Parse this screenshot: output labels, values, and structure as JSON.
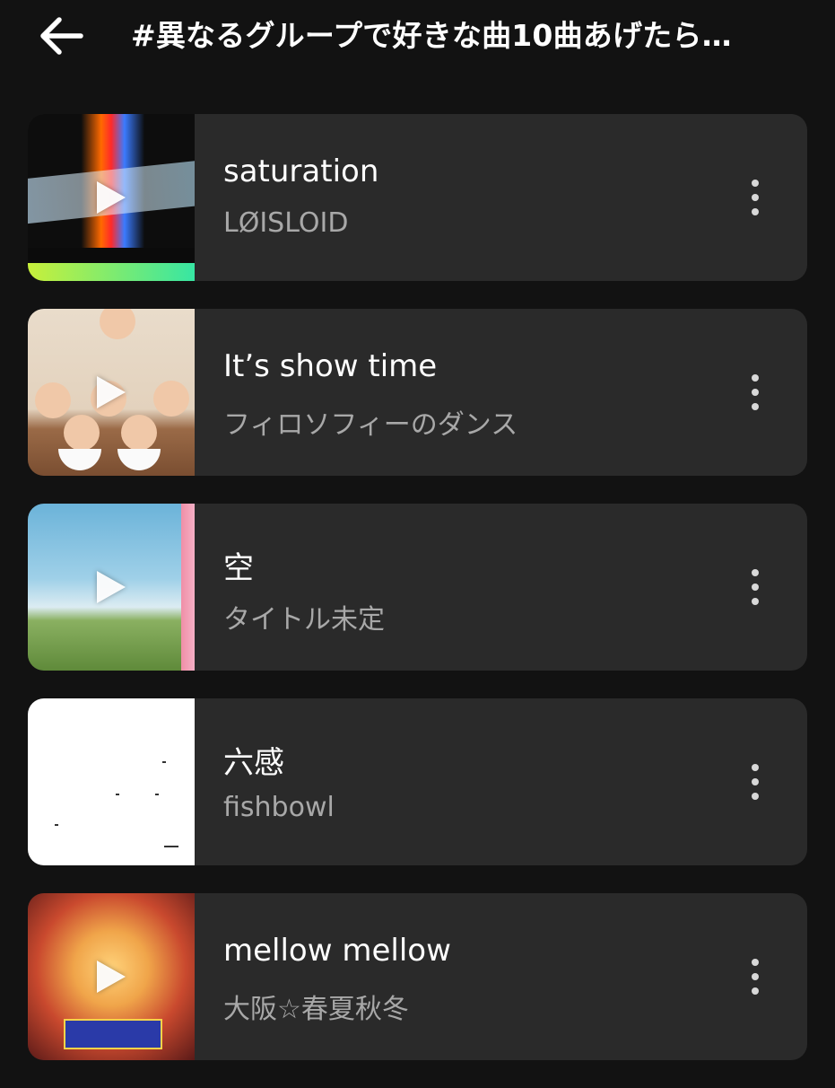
{
  "header": {
    "title": "#異なるグループで好きな曲10曲あげたら…",
    "back_icon": "arrow-left-icon"
  },
  "songs": [
    {
      "title": "saturation",
      "artist": "LØISLOID",
      "art": "art-1"
    },
    {
      "title": "It’s show time",
      "artist": "フィロソフィーのダンス",
      "art": "art-2"
    },
    {
      "title": "空",
      "artist": "タイトル未定",
      "art": "art-3"
    },
    {
      "title": "六感",
      "artist": "fishbowl",
      "art": "art-4"
    },
    {
      "title": "mellow mellow",
      "artist": "大阪☆春夏秋冬",
      "art": "art-5"
    }
  ],
  "colors": {
    "background": "#121212",
    "card": "#2a2a2a",
    "secondary_text": "#a8a8a8"
  }
}
